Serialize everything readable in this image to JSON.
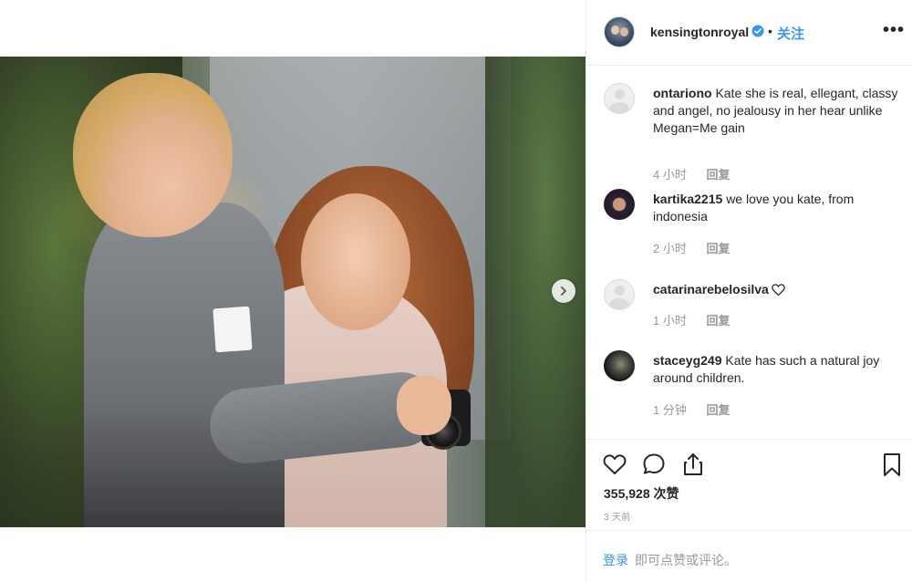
{
  "post": {
    "author": {
      "username": "kensingtonroyal",
      "verified": true,
      "separator": "•",
      "follow_label": "关注"
    },
    "more_label": "•••",
    "media": {
      "next_label": "›"
    }
  },
  "comments": [
    {
      "username": "ontariono",
      "text": "Kate she is real, ellegant, classy and angel, no jealousy in her hear unlike Megan=Me gain",
      "time": "4 小时",
      "reply_label": "回复"
    },
    {
      "username": "kartika2215",
      "text": "we love you kate, from indonesia",
      "time": "2 小时",
      "reply_label": "回复"
    },
    {
      "username": "catarinarebelosilva",
      "text": "",
      "time": "1 小时",
      "reply_label": "回复"
    },
    {
      "username": "staceyg249",
      "text": "Kate has such a natural joy around children.",
      "time": "1 分钟",
      "reply_label": "回复"
    }
  ],
  "actions": {
    "likes": "355,928 次赞",
    "age": "3 天前"
  },
  "login_bar": {
    "login_label": "登录",
    "prompt": "即可点赞或评论。"
  },
  "colors": {
    "link": "#3897f0",
    "muted": "#999999",
    "text": "#262626",
    "verified": "#3897f0"
  },
  "icons": {
    "like": "heart-icon",
    "comment": "comment-bubble-icon",
    "share": "share-icon",
    "save": "bookmark-icon",
    "verified": "verified-badge-icon",
    "more": "more-options-icon",
    "next": "chevron-right-icon"
  }
}
